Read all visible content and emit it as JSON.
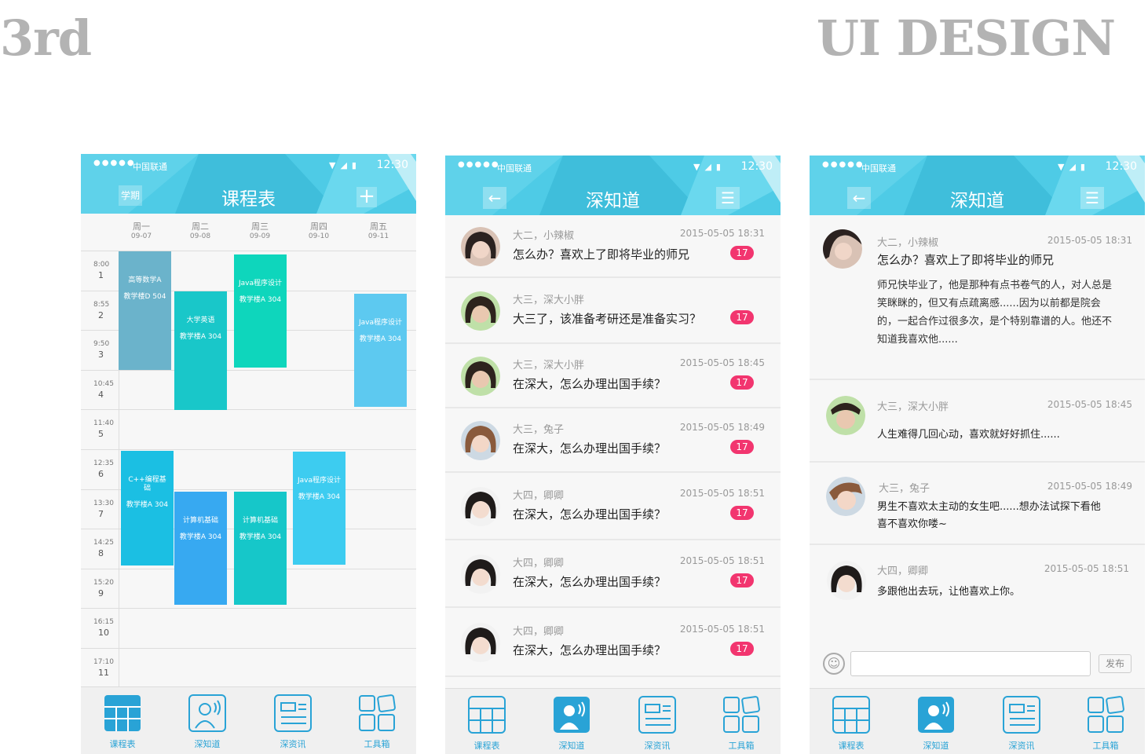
{
  "header": {
    "left_title": "3rd",
    "right_title": "UI DESIGN"
  },
  "status": {
    "carrier": "中国联通",
    "time": "12:30",
    "dots": "●●●●●"
  },
  "colors": {
    "bar": "#4ecbe6",
    "badge": "#f2356f",
    "tab_active": "#29a3d6"
  },
  "schedule": {
    "title": "课程表",
    "left_button": "学期",
    "plus": "+",
    "days": [
      {
        "name": "周一",
        "date": "09-07"
      },
      {
        "name": "周二",
        "date": "09-08"
      },
      {
        "name": "周三",
        "date": "09-09"
      },
      {
        "name": "周四",
        "date": "09-10"
      },
      {
        "name": "周五",
        "date": "09-11"
      }
    ],
    "slots": [
      {
        "time": "8:00",
        "num": "1"
      },
      {
        "time": "8:55",
        "num": "2"
      },
      {
        "time": "9:50",
        "num": "3"
      },
      {
        "time": "10:45",
        "num": "4"
      },
      {
        "time": "11:40",
        "num": "5"
      },
      {
        "time": "12:35",
        "num": "6"
      },
      {
        "time": "13:30",
        "num": "7"
      },
      {
        "time": "14:25",
        "num": "8"
      },
      {
        "time": "15:20",
        "num": "9"
      },
      {
        "time": "16:15",
        "num": "10"
      },
      {
        "time": "17:10",
        "num": "11"
      }
    ],
    "courses": [
      {
        "name": "高等数学A",
        "room": "教学楼D 504",
        "color": "#6bb3cb"
      },
      {
        "name": "大学英语",
        "room": "教学楼A 304",
        "color": "#19c7c9"
      },
      {
        "name": "Java程序设计",
        "room": "教学楼A 304",
        "color": "#0ed6bc"
      },
      {
        "name": "Java程序设计",
        "room": "教学楼A 304",
        "color": "#5dc9f0"
      },
      {
        "name": "C++编程基础",
        "room": "教学楼A 304",
        "color": "#1bbfe3"
      },
      {
        "name": "计算机基础",
        "room": "教学楼A 304",
        "color": "#37a9f1"
      },
      {
        "name": "计算机基础",
        "room": "教学楼A 304",
        "color": "#16c7c9"
      },
      {
        "name": "Java程序设计",
        "room": "教学楼A 304",
        "color": "#3dccf0"
      }
    ]
  },
  "feed": {
    "title": "深知道",
    "back": "←",
    "menu": "☰",
    "items": [
      {
        "author": "大二，小辣椒",
        "time": "2015-05-05 18:31",
        "text": "怎么办？喜欢上了即将毕业的师兄",
        "badge": "17"
      },
      {
        "author": "大三，深大小胖",
        "time": "",
        "text": "大三了，该准备考研还是准备实习？",
        "badge": "17"
      },
      {
        "author": "大三，深大小胖",
        "time": "2015-05-05 18:45",
        "text": "在深大，怎么办理出国手续？",
        "badge": "17"
      },
      {
        "author": "大三，兔子",
        "time": "2015-05-05 18:49",
        "text": "在深大，怎么办理出国手续？",
        "badge": "17"
      },
      {
        "author": "大四，卿卿",
        "time": "2015-05-05 18:51",
        "text": "在深大，怎么办理出国手续？",
        "badge": "17"
      },
      {
        "author": "大四，卿卿",
        "time": "2015-05-05 18:51",
        "text": "在深大，怎么办理出国手续？",
        "badge": "17"
      },
      {
        "author": "大四，卿卿",
        "time": "2015-05-05 18:51",
        "text": "在深大，怎么办理出国手续？",
        "badge": "17"
      }
    ]
  },
  "detail": {
    "title": "深知道",
    "post": {
      "author": "大二，小辣椒",
      "time": "2015-05-05 18:31",
      "text": "怎么办？喜欢上了即将毕业的师兄",
      "body": "师兄快毕业了，他是那种有点书卷气的人，对人总是笑眯眯的，但又有点疏离感......因为以前都是院会的，一起合作过很多次，是个特别靠谱的人。他还不知道我喜欢他......"
    },
    "replies": [
      {
        "author": "大三，深大小胖",
        "time": "2015-05-05 18:45",
        "text": "人生难得几回心动，喜欢就好好抓住......"
      },
      {
        "author": "大三，兔子",
        "time": "2015-05-05 18:49",
        "text": "男生不喜欢太主动的女生吧......想办法试探下看他喜不喜欢你喽~"
      },
      {
        "author": "大四，卿卿",
        "time": "2015-05-05 18:51",
        "text": "多跟他出去玩，让他喜欢上你。"
      }
    ],
    "send": "发布"
  },
  "tabs": [
    {
      "label": "课程表",
      "icon": "grid-icon"
    },
    {
      "label": "深知道",
      "icon": "person-wave-icon"
    },
    {
      "label": "深资讯",
      "icon": "news-icon"
    },
    {
      "label": "工具箱",
      "icon": "toolbox-icon"
    }
  ]
}
